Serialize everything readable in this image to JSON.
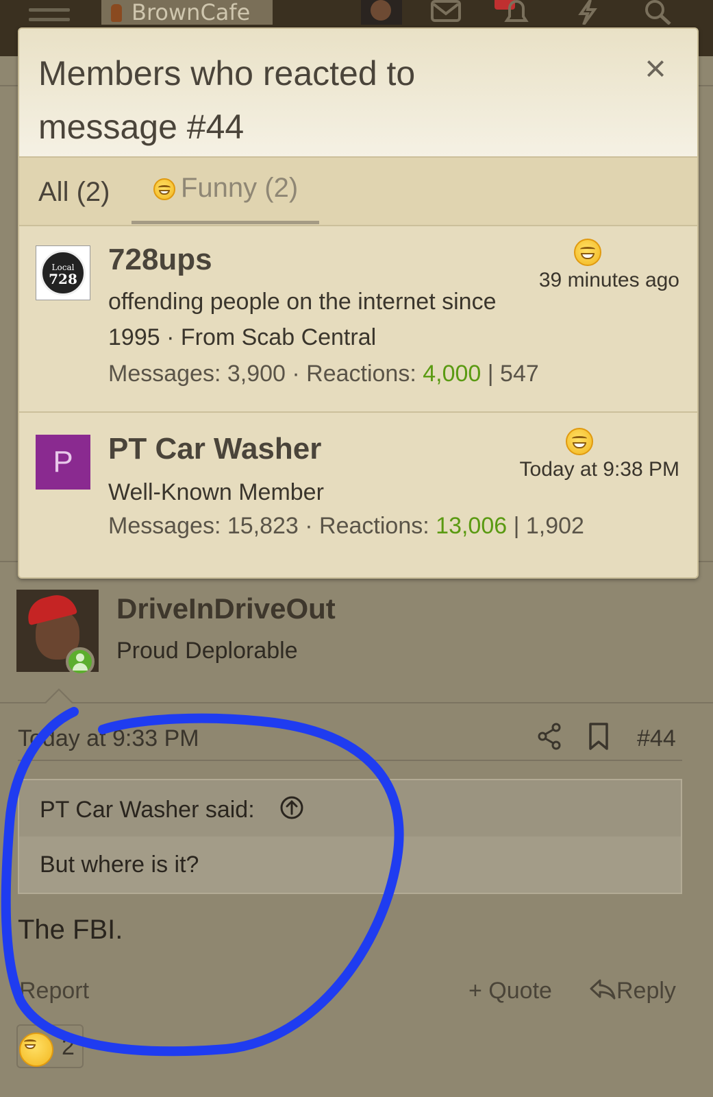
{
  "header": {
    "site_name": "BrownCafe"
  },
  "popup": {
    "title": "Members who reacted to message #44",
    "close_label": "×",
    "tabs": [
      {
        "label": "All (2)"
      },
      {
        "label": "Funny (2)",
        "icon": "funny-emoji-icon",
        "active": true
      }
    ],
    "members": [
      {
        "name": "728ups",
        "title": "offending people on the internet since 1995 · From Scab Central",
        "messages_label": "Messages: 3,900 · Reactions: ",
        "reactions": "4,000",
        "points": " | 547",
        "time": "39 minutes ago",
        "avatar_text_small": "Local",
        "avatar_text_big": "728"
      },
      {
        "name": "PT Car Washer",
        "title": "Well-Known Member",
        "messages_label": "Messages: 15,823 · Reactions: ",
        "reactions": "13,006",
        "points": " | 1,902",
        "time": "Today at 9:38 PM",
        "avatar_letter": "P"
      }
    ]
  },
  "post": {
    "username": "DriveInDriveOut",
    "user_title": "Proud Deplorable",
    "time": "Today at 9:33 PM",
    "number": "#44",
    "quote_author": "PT Car Washer said:",
    "quote_text": "But where is it?",
    "body": "The FBI.",
    "report_label": "Report",
    "quote_label": "+ Quote",
    "reply_label": "Reply",
    "reaction_count": "2"
  },
  "colors": {
    "page_bg": "#8f8770",
    "popup_bg": "#e6dcbe",
    "reactions_green": "#5a9a12",
    "scribble_blue": "#1f3cf0",
    "avatar_purple": "#8a2a90"
  }
}
